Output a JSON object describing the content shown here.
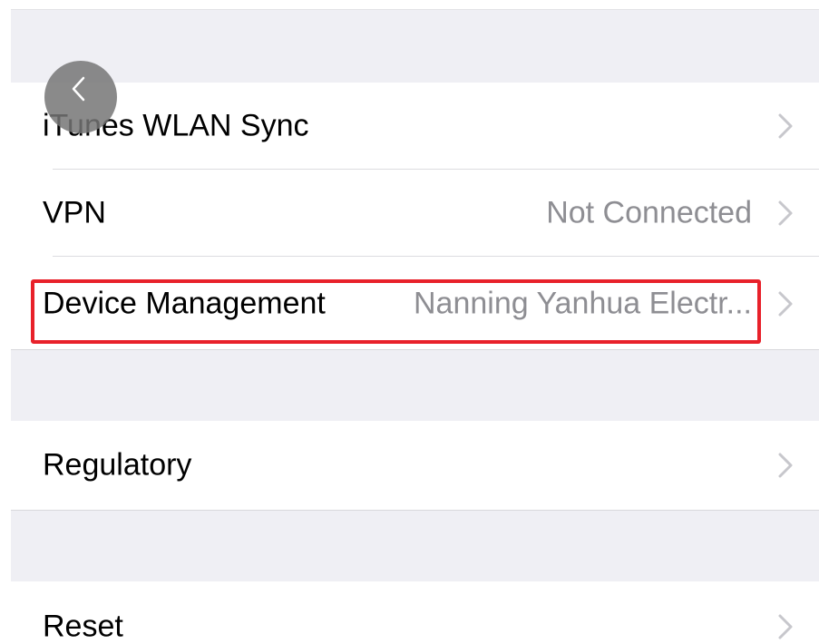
{
  "settings": {
    "rows": [
      {
        "label": "iTunes WLAN Sync",
        "value": ""
      },
      {
        "label": "VPN",
        "value": "Not Connected"
      },
      {
        "label": "Device Management",
        "value": "Nanning Yanhua Electr..."
      },
      {
        "label": "Regulatory",
        "value": ""
      },
      {
        "label": "Reset",
        "value": ""
      }
    ]
  },
  "icons": {
    "back": "chevron-left-icon",
    "disclosure": "chevron-right-icon"
  },
  "colors": {
    "group_background": "#efeff4",
    "value_text": "#8e8e93",
    "highlight": "#e8212a",
    "back_button": "#767676"
  }
}
